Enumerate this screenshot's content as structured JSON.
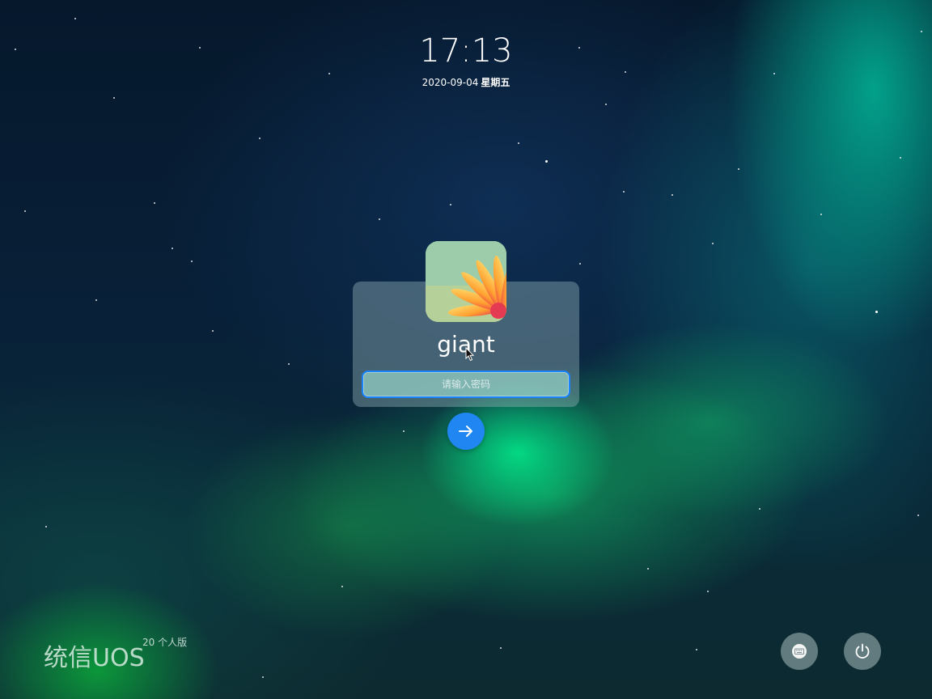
{
  "clock": {
    "time": "17:13",
    "date": "2020-09-04",
    "weekday": "星期五"
  },
  "login": {
    "username": "giant",
    "password_placeholder": "请输入密码",
    "password_value": ""
  },
  "icons": {
    "avatar": "flower-avatar",
    "submit": "arrow-right-icon",
    "keyboard": "keyboard-icon",
    "power": "power-icon"
  },
  "brand": {
    "name": "统信UOS",
    "edition": "20 个人版"
  },
  "colors": {
    "accent": "#1f86f2",
    "focus_border": "#1a84ff"
  }
}
